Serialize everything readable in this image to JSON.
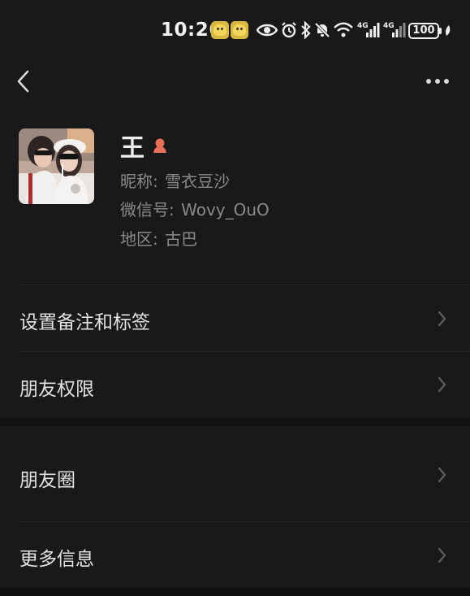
{
  "status_bar": {
    "time": "10:26",
    "network_1": "4G",
    "network_2": "4G",
    "battery": "100",
    "icons": [
      "emoji-sticker-icon",
      "emoji-sticker-icon",
      "eye-icon",
      "alarm-icon",
      "bluetooth-icon",
      "mute-icon",
      "wifi-icon",
      "signal-icon",
      "signal-icon",
      "battery-icon",
      "charging-icon"
    ]
  },
  "nav": {
    "back_icon": "chevron-left-icon",
    "more_icon": "more-dots-icon"
  },
  "profile": {
    "name": "王",
    "gender_icon": "female-icon",
    "gender_color": "#e8705a",
    "nickname_label": "昵称:",
    "nickname": "雪衣豆沙",
    "wechat_id_label": "微信号:",
    "wechat_id": "Wovy_OuO",
    "region_label": "地区:",
    "region": "古巴"
  },
  "menu": {
    "remarks_tags": "设置备注和标签",
    "friend_permissions": "朋友权限",
    "moments": "朋友圈",
    "more_info": "更多信息"
  },
  "colors": {
    "background": "#191919",
    "section_gap": "#111111",
    "primary_text": "#e2e2e2",
    "secondary_text": "#8a8a8a"
  }
}
